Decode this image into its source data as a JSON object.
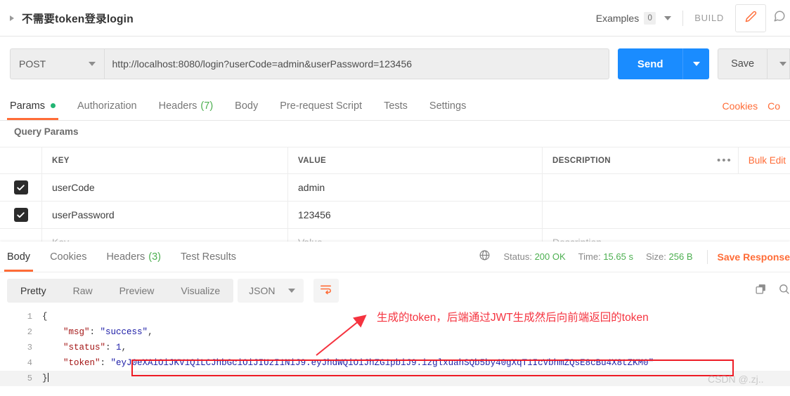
{
  "titlebar": {
    "request_name": "不需要token登录login",
    "examples_label": "Examples",
    "examples_count": "0",
    "build_label": "BUILD",
    "edit_icon": "pencil-icon",
    "comment_icon": "comment-icon"
  },
  "request": {
    "method": "POST",
    "url": "http://localhost:8080/login?userCode=admin&userPassword=123456",
    "send_label": "Send",
    "save_label": "Save"
  },
  "request_tabs": [
    {
      "label": "Params",
      "active": true,
      "dot": true
    },
    {
      "label": "Authorization",
      "active": false
    },
    {
      "label": "Headers",
      "count": "(7)",
      "active": false
    },
    {
      "label": "Body",
      "active": false
    },
    {
      "label": "Pre-request Script",
      "active": false
    },
    {
      "label": "Tests",
      "active": false
    },
    {
      "label": "Settings",
      "active": false
    }
  ],
  "tabs_right": {
    "cookies": "Cookies",
    "code": "Co"
  },
  "query_params": {
    "section_label": "Query Params",
    "columns": {
      "key": "KEY",
      "value": "VALUE",
      "description": "DESCRIPTION"
    },
    "more_icon": "•••",
    "bulk_edit": "Bulk Edit",
    "rows": [
      {
        "checked": true,
        "key": "userCode",
        "value": "admin",
        "description": ""
      },
      {
        "checked": true,
        "key": "userPassword",
        "value": "123456",
        "description": ""
      }
    ],
    "new_row": {
      "key": "Key",
      "value": "Value",
      "description": "Description"
    }
  },
  "response": {
    "tabs": [
      {
        "label": "Body",
        "active": true
      },
      {
        "label": "Cookies",
        "active": false
      },
      {
        "label": "Headers",
        "count": "(3)",
        "active": false
      },
      {
        "label": "Test Results",
        "active": false
      }
    ],
    "globe_icon": "globe-icon",
    "status_label": "Status:",
    "status_value": "200 OK",
    "time_label": "Time:",
    "time_value": "15.65 s",
    "size_label": "Size:",
    "size_value": "256 B",
    "save_response": "Save Response",
    "view_modes": [
      {
        "label": "Pretty",
        "active": true
      },
      {
        "label": "Raw",
        "active": false
      },
      {
        "label": "Preview",
        "active": false
      },
      {
        "label": "Visualize",
        "active": false
      }
    ],
    "format": "JSON",
    "wrap_icon": "wrap-lines-icon",
    "copy_icon": "copy-icon",
    "search_icon": "search-icon",
    "body_lines": [
      {
        "n": "1",
        "segments": [
          {
            "t": "{",
            "c": "p"
          }
        ]
      },
      {
        "n": "2",
        "segments": [
          {
            "t": "    ",
            "c": "p"
          },
          {
            "t": "\"msg\"",
            "c": "k"
          },
          {
            "t": ": ",
            "c": "p"
          },
          {
            "t": "\"success\"",
            "c": "s"
          },
          {
            "t": ",",
            "c": "p"
          }
        ]
      },
      {
        "n": "3",
        "segments": [
          {
            "t": "    ",
            "c": "p"
          },
          {
            "t": "\"status\"",
            "c": "k"
          },
          {
            "t": ": ",
            "c": "p"
          },
          {
            "t": "1",
            "c": "n"
          },
          {
            "t": ",",
            "c": "p"
          }
        ]
      },
      {
        "n": "4",
        "segments": [
          {
            "t": "    ",
            "c": "p"
          },
          {
            "t": "\"token\"",
            "c": "k"
          },
          {
            "t": ": ",
            "c": "p"
          },
          {
            "t": "\"eyJ0eXAiOiJKV1QiLCJhbGciOiJIUzI1NiJ9.eyJhdWQiOiJhZG1pbiJ9.izglxuahSQb5by40gXqT1IcVbhmZQsE8cBu4X8tZKM0\"",
            "c": "s"
          }
        ]
      },
      {
        "n": "5",
        "segments": [
          {
            "t": "}",
            "c": "p"
          }
        ]
      }
    ]
  },
  "annotation": {
    "text": "生成的token，后端通过JWT生成然后向前端返回的token",
    "color": "#f5333f",
    "highlight_box_color": "#ee1c25"
  },
  "watermark": "CSDN @.zj..",
  "colors": {
    "accent_orange": "#ff6c37",
    "send_blue": "#1a8cff",
    "status_green": "#4caf50",
    "annotation_red": "#f5333f"
  }
}
